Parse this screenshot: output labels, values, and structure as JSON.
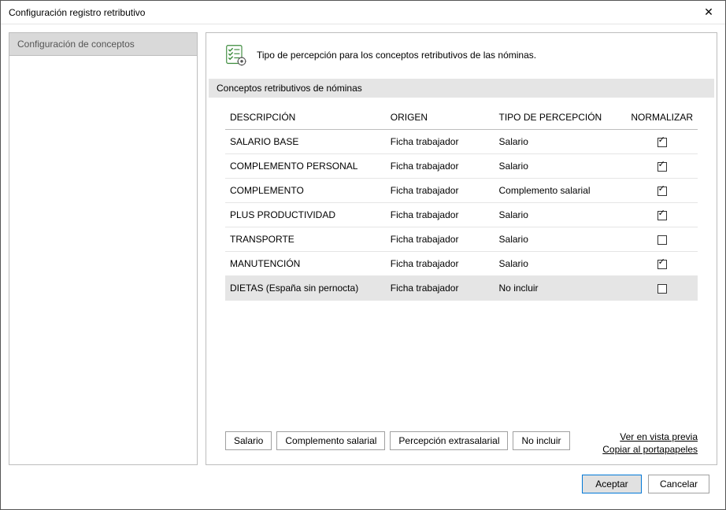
{
  "window": {
    "title": "Configuración registro retributivo"
  },
  "sidebar": {
    "items": [
      {
        "label": "Configuración de conceptos"
      }
    ]
  },
  "header": {
    "description": "Tipo de percepción para los conceptos retributivos de las nóminas."
  },
  "section": {
    "title": "Conceptos retributivos de nóminas"
  },
  "table": {
    "columns": {
      "descripcion": "DESCRIPCIÓN",
      "origen": "ORIGEN",
      "tipo": "TIPO DE PERCEPCIÓN",
      "normalizar": "NORMALIZAR"
    },
    "rows": [
      {
        "descripcion": "SALARIO BASE",
        "origen": "Ficha trabajador",
        "tipo": "Salario",
        "normalizar": true
      },
      {
        "descripcion": "COMPLEMENTO PERSONAL",
        "origen": "Ficha trabajador",
        "tipo": "Salario",
        "normalizar": true
      },
      {
        "descripcion": "COMPLEMENTO",
        "origen": "Ficha trabajador",
        "tipo": "Complemento salarial",
        "normalizar": true
      },
      {
        "descripcion": "PLUS PRODUCTIVIDAD",
        "origen": "Ficha trabajador",
        "tipo": "Salario",
        "normalizar": true
      },
      {
        "descripcion": "TRANSPORTE",
        "origen": "Ficha trabajador",
        "tipo": "Salario",
        "normalizar": false
      },
      {
        "descripcion": "MANUTENCIÓN",
        "origen": "Ficha trabajador",
        "tipo": "Salario",
        "normalizar": true
      },
      {
        "descripcion": "DIETAS (España sin pernocta)",
        "origen": "Ficha trabajador",
        "tipo": "No incluir",
        "normalizar": false
      }
    ]
  },
  "buttons": {
    "salario": "Salario",
    "complemento": "Complemento salarial",
    "extrasalarial": "Percepción extrasalarial",
    "no_incluir": "No incluir"
  },
  "links": {
    "preview": "Ver en vista previa",
    "copy": "Copiar al portapapeles"
  },
  "footer": {
    "accept": "Aceptar",
    "cancel": "Cancelar"
  }
}
